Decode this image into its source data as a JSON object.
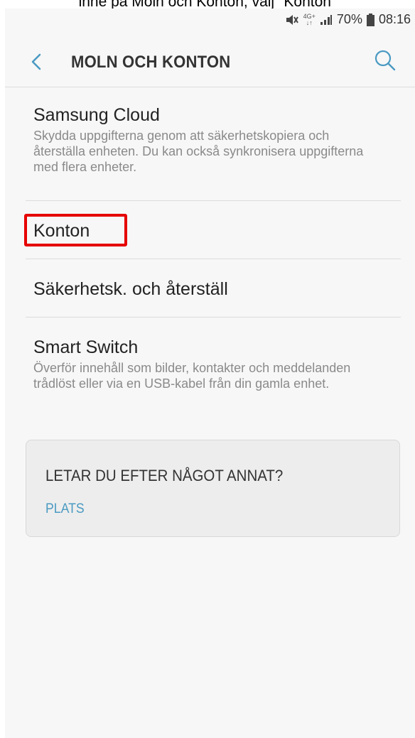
{
  "caption": "inne på Moln och Konton, välj \"Konton\"",
  "statusbar": {
    "network": "4G+",
    "battery": "70%",
    "time": "08:16"
  },
  "appbar": {
    "title": "MOLN OCH KONTON",
    "back_icon": "chevron-left-icon",
    "search_icon": "search-icon"
  },
  "items": [
    {
      "title": "Samsung Cloud",
      "subtitle": "Skydda uppgifterna genom att säkerhetskopiera och återställa enheten. Du kan också synkronisera uppgifterna med flera enheter."
    },
    {
      "title": "Konton"
    },
    {
      "title": "Säkerhetsk. och återställ"
    },
    {
      "title": "Smart Switch",
      "subtitle": "Överför innehåll som bilder, kontakter och meddelanden trådlöst eller via en USB-kabel från din gamla enhet."
    }
  ],
  "card": {
    "title": "LETAR DU EFTER NÅGOT ANNAT?",
    "link": "PLATS"
  },
  "colors": {
    "accent": "#4a9ac2",
    "highlight": "#e60000",
    "background": "#f7f7f7"
  }
}
